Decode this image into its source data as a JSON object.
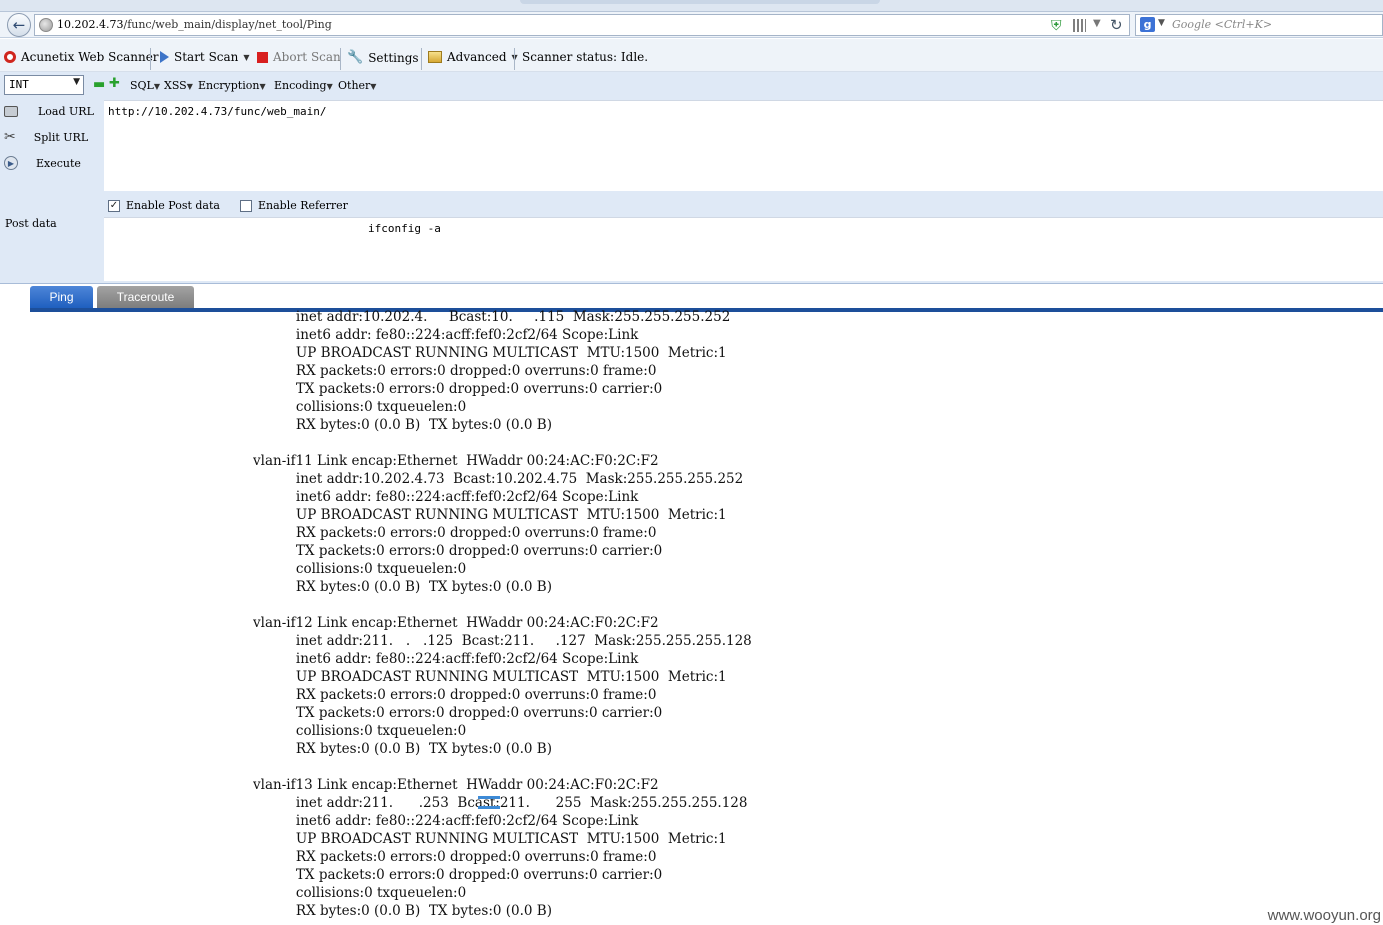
{
  "browser": {
    "url_host": "10.202.4.73",
    "url_path": "/func/web_main/display/net_tool/Ping",
    "search_placeholder": "Google <Ctrl+K>",
    "search_engine_icon": "g-icon"
  },
  "acunetix": {
    "title": "Acunetix Web Scanner",
    "start_scan": "Start Scan",
    "abort_scan": "Abort Scan",
    "settings": "Settings",
    "advanced": "Advanced",
    "status": "Scanner status: Idle."
  },
  "hackbar": {
    "select_value": "INT",
    "menus": [
      "SQL",
      "XSS",
      "Encryption",
      "Encoding",
      "Other"
    ],
    "load_url": "Load URL",
    "split_url": "Split URL",
    "execute": "Execute",
    "url_value": "http://10.202.4.73/func/web_main/",
    "enable_post": "Enable Post data",
    "enable_post_checked": true,
    "enable_referrer": "Enable Referrer",
    "enable_referrer_checked": false,
    "post_label": "Post data",
    "post_value": "ifconfig -a"
  },
  "tabs": [
    "Ping",
    "Traceroute"
  ],
  "output_lines": [
    "          inet addr:10.202.4.     Bcast:10.     .115  Mask:255.255.255.252",
    "          inet6 addr: fe80::224:acff:fef0:2cf2/64 Scope:Link",
    "          UP BROADCAST RUNNING MULTICAST  MTU:1500  Metric:1",
    "          RX packets:0 errors:0 dropped:0 overruns:0 frame:0",
    "          TX packets:0 errors:0 dropped:0 overruns:0 carrier:0",
    "          collisions:0 txqueuelen:0",
    "          RX bytes:0 (0.0 B)  TX bytes:0 (0.0 B)",
    "",
    "vlan-if11 Link encap:Ethernet  HWaddr 00:24:AC:F0:2C:F2",
    "          inet addr:10.202.4.73  Bcast:10.202.4.75  Mask:255.255.255.252",
    "          inet6 addr: fe80::224:acff:fef0:2cf2/64 Scope:Link",
    "          UP BROADCAST RUNNING MULTICAST  MTU:1500  Metric:1",
    "          RX packets:0 errors:0 dropped:0 overruns:0 frame:0",
    "          TX packets:0 errors:0 dropped:0 overruns:0 carrier:0",
    "          collisions:0 txqueuelen:0",
    "          RX bytes:0 (0.0 B)  TX bytes:0 (0.0 B)",
    "",
    "vlan-if12 Link encap:Ethernet  HWaddr 00:24:AC:F0:2C:F2",
    "          inet addr:211.   .   .125  Bcast:211.     .127  Mask:255.255.255.128",
    "          inet6 addr: fe80::224:acff:fef0:2cf2/64 Scope:Link",
    "          UP BROADCAST RUNNING MULTICAST  MTU:1500  Metric:1",
    "          RX packets:0 errors:0 dropped:0 overruns:0 frame:0",
    "          TX packets:0 errors:0 dropped:0 overruns:0 carrier:0",
    "          collisions:0 txqueuelen:0",
    "          RX bytes:0 (0.0 B)  TX bytes:0 (0.0 B)",
    "",
    "vlan-if13 Link encap:Ethernet  HWaddr 00:24:AC:F0:2C:F2",
    "          inet addr:211.      .253  Bcast:211.      255  Mask:255.255.255.128",
    "          inet6 addr: fe80::224:acff:fef0:2cf2/64 Scope:Link",
    "          UP BROADCAST RUNNING MULTICAST  MTU:1500  Metric:1",
    "          RX packets:0 errors:0 dropped:0 overruns:0 frame:0",
    "          TX packets:0 errors:0 dropped:0 overruns:0 carrier:0",
    "          collisions:0 txqueuelen:0",
    "          RX bytes:0 (0.0 B)  TX bytes:0 (0.0 B)"
  ],
  "watermark": "www.wooyun.org",
  "colors": {
    "tab_active": "#1f5fbf",
    "tab_inactive": "#8a8a8a",
    "tab_line": "#1d4f9a",
    "hackbar_bg": "#dfe9f6"
  }
}
